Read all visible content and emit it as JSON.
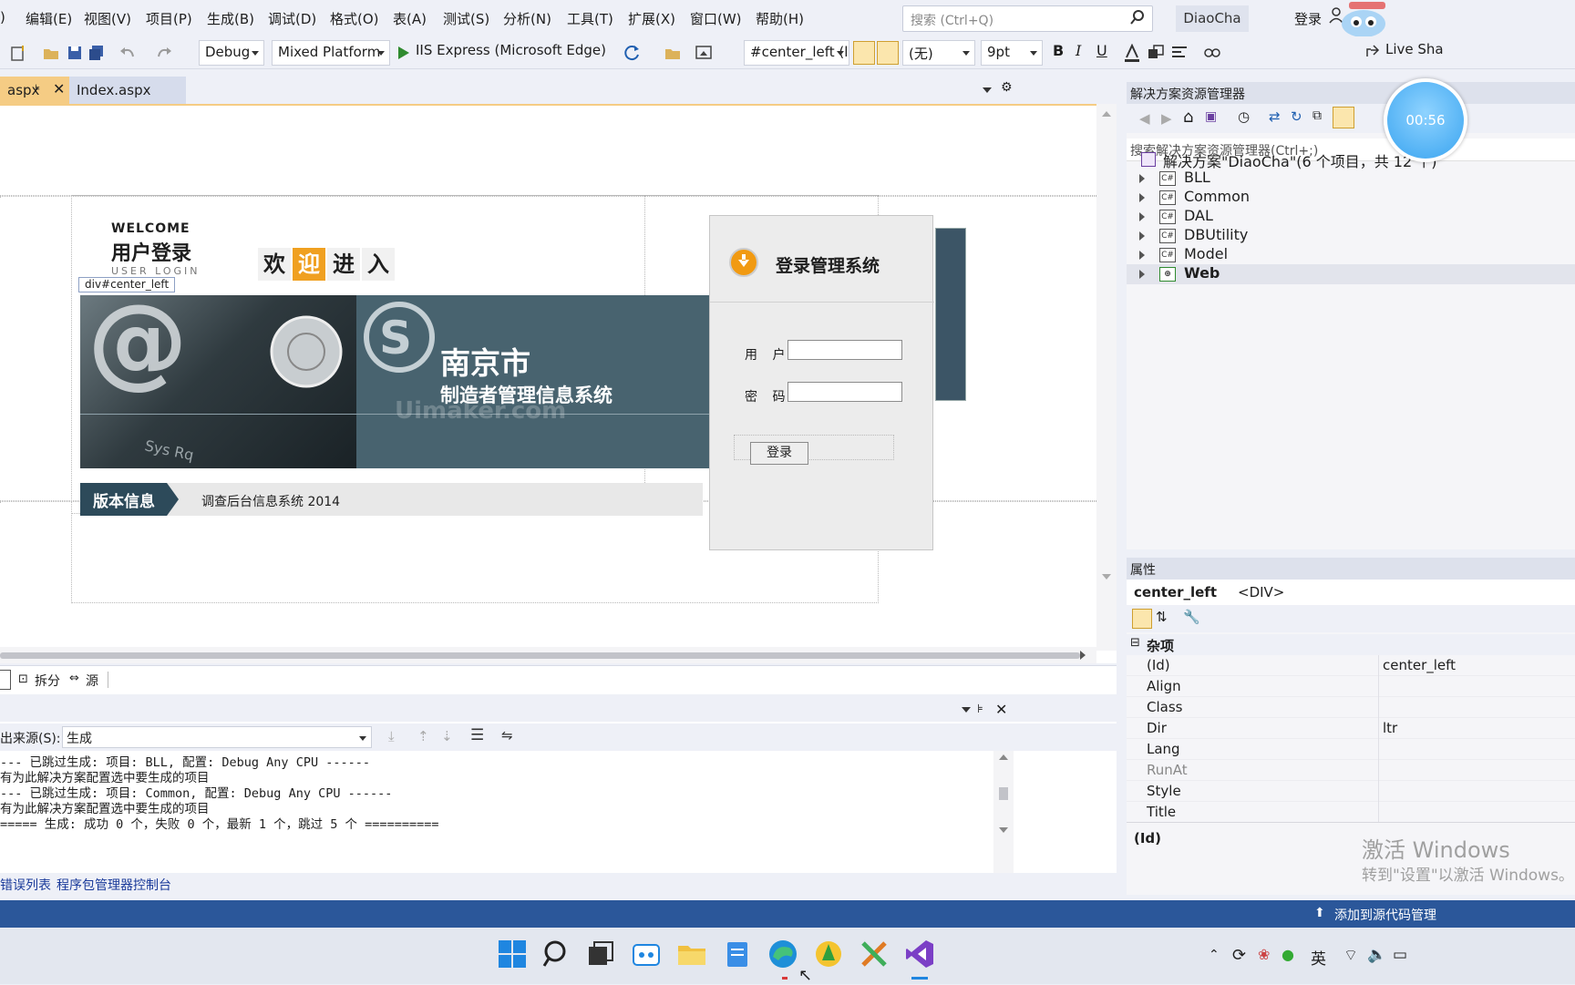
{
  "menu": {
    "items": [
      "编辑(E)",
      "视图(V)",
      "项目(P)",
      "生成(B)",
      "调试(D)",
      "格式(O)",
      "表(A)",
      "测试(S)",
      "分析(N)",
      "工具(T)",
      "扩展(X)",
      "窗口(W)",
      "帮助(H)"
    ],
    "search_placeholder": "搜索 (Ctrl+Q)",
    "solution_name": "DiaoCha",
    "signin": "登录",
    "live_share": "Live Sha"
  },
  "toolbar": {
    "config": "Debug",
    "platform": "Mixed Platform",
    "run_target": "IIS Express (Microsoft Edge)",
    "element_selector": "#center_left (lc",
    "style": "(无)",
    "font_size": "9pt"
  },
  "tabs": {
    "first": "aspx",
    "second": "Index.aspx"
  },
  "page": {
    "welcome": "WELCOME",
    "title": "用户登录",
    "subtitle": "USER LOGIN",
    "welcome_chars": [
      "欢",
      "迎",
      "进",
      "入"
    ],
    "div_tag": "div#center_left",
    "city": "南京市",
    "system_name": "制造者管理信息系统",
    "watermark": "Uimaker.com",
    "version_label": "版本信息",
    "version_text": "调查后台信息系统 2014",
    "login_title": "登录管理系统",
    "user_label": "用 户",
    "password_label": "密 码",
    "login_button": "登录"
  },
  "viewbar": {
    "split": "拆分",
    "source": "源"
  },
  "solution_explorer": {
    "title": "解决方案资源管理器",
    "search_placeholder": "搜索解决方案资源管理器(Ctrl+;)",
    "solution_label": "解决方案\"DiaoCha\"(6 个项目，共 12 个)",
    "projects": [
      "BLL",
      "Common",
      "DAL",
      "DBUtility",
      "Model",
      "Web"
    ]
  },
  "timer": "00:56",
  "properties": {
    "title": "属性",
    "object_name": "center_left",
    "object_type": "<DIV>",
    "category": "杂项",
    "rows": [
      {
        "key": "(Id)",
        "value": "center_left"
      },
      {
        "key": "Align",
        "value": ""
      },
      {
        "key": "Class",
        "value": ""
      },
      {
        "key": "Dir",
        "value": "ltr"
      },
      {
        "key": "Lang",
        "value": ""
      },
      {
        "key": "RunAt",
        "value": ""
      },
      {
        "key": "Style",
        "value": ""
      },
      {
        "key": "Title",
        "value": ""
      }
    ],
    "description": "(Id)"
  },
  "watermark_windows": {
    "line1": "激活 Windows",
    "line2": "转到\"设置\"以激活 Windows。"
  },
  "output": {
    "source_label": "出来源(S):",
    "source_value": "生成",
    "lines": [
      "--- 已跳过生成: 项目: BLL, 配置: Debug Any CPU ------",
      "有为此解决方案配置选中要生成的项目",
      "--- 已跳过生成: 项目: Common, 配置: Debug Any CPU ------",
      "有为此解决方案配置选中要生成的项目",
      "===== 生成: 成功 0 个，失败 0 个，最新 1 个，跳过 5 个 =========="
    ]
  },
  "bottom_tabs": [
    "错误列表",
    "程序包管理器控制台"
  ],
  "status": {
    "source_control": "添加到源代码管理"
  },
  "taskbar": {
    "ime": "英"
  },
  "colors": {
    "accent": "#2b579a",
    "banner": "#48636f"
  }
}
